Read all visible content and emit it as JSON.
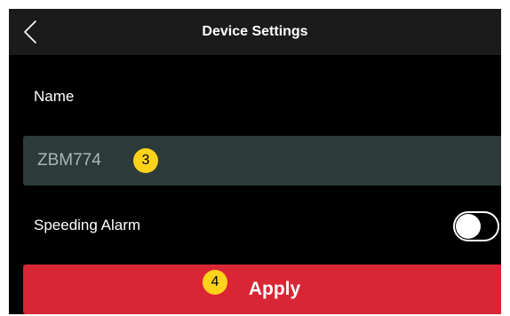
{
  "header": {
    "title": "Device Settings",
    "back_icon": "chevron-left-icon"
  },
  "form": {
    "name_label": "Name",
    "name_value": "ZBM774",
    "speeding_alarm_label": "Speeding Alarm",
    "speeding_alarm_on": false
  },
  "apply": {
    "label": "Apply"
  },
  "callouts": {
    "name_step": "3",
    "apply_step": "4"
  },
  "colors": {
    "background": "#000000",
    "header": "#1b1b1b",
    "input_bg": "#2c3b3a",
    "input_text": "#aab6b5",
    "apply_bg": "#d92635",
    "callout": "#ffd21c"
  }
}
